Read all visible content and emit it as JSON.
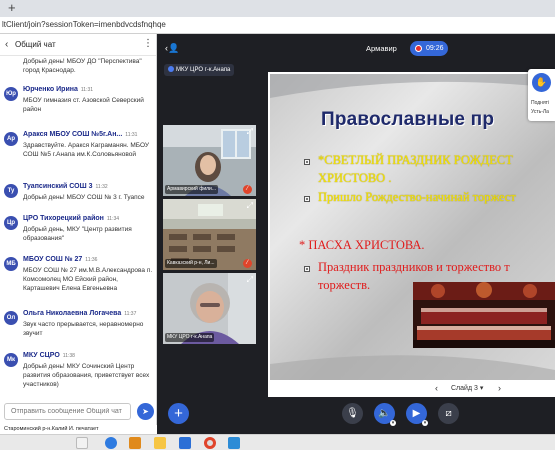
{
  "browser": {
    "new_tab_glyph": "+",
    "url": "ltClient/join?sessionToken=imenbdvcdsfnqhqe"
  },
  "chat": {
    "title": "Общий чат",
    "messages": [
      {
        "initials": "",
        "name": "",
        "time": "",
        "text": "Добрый день! МБОУ ДО \"Перспектива\" город Краснодар."
      },
      {
        "initials": "Юр",
        "name": "Юрченко Ирина",
        "time": "11:31",
        "text": "МБОУ гимназия ст. Азовской Северский район"
      },
      {
        "initials": "Ар",
        "name": "Аракся МБОУ СОШ №5г.Ан...",
        "time": "11:31",
        "text": "Здравствуйте. Аракся Каграманян. МБОУ СОШ №5 г.Анапа им.К.Соловьяновой"
      },
      {
        "initials": "Ту",
        "name": "Туапсинский СОШ 3",
        "time": "11:32",
        "text": "Добрый день! МБОУ СОШ № 3 г. Туапсе"
      },
      {
        "initials": "Цр",
        "name": "ЦРО Тихорецкий район",
        "time": "11:34",
        "text": "Добрый день, МКУ \"Центр развития образования\""
      },
      {
        "initials": "МБ",
        "name": "МБОУ СОШ № 27",
        "time": "11:36",
        "text": "МБОУ СОШ № 27 им.М.В.Александрова п. Комсомолец МО Ейский район, Карташевич Елена Евгеньевна"
      },
      {
        "initials": "Ол",
        "name": "Ольга Николаевна Логачева",
        "time": "11:37",
        "text": "Звук часто прерывается, неравномерно звучит"
      },
      {
        "initials": "Мк",
        "name": "МКУ СЦРО",
        "time": "11:38",
        "text": "Добрый день! МКУ Сочинский Центр развития образования, приветствует всех участников)"
      }
    ],
    "input_placeholder": "Отправить сообщение Общий чат",
    "typing_text": "Староминский р-н.Калий И. печатает"
  },
  "meeting": {
    "room_name": "Армавир",
    "recording_time": "09:26",
    "presenter": "МКУ ЦРО г-к.Анапа",
    "tiles": [
      {
        "label": "Армавирский фили..."
      },
      {
        "label": "Кавказский р-н, Ли..."
      },
      {
        "label": "МКУ ЦРО г-к.Анапа"
      }
    ],
    "slide": {
      "title": "Православные пр",
      "line1": "*СВЕТЛЫЙ ПРАЗДНИК РОЖДЕСТ",
      "line2": "ХРИСТОВО .",
      "line3": "Пришло Рождество-начинай торжест",
      "line4": "* ПАСХА ХРИСТОВА.",
      "line5": "Праздник праздников и торжество т",
      "line6": "торжеств."
    },
    "slide_number": "Слайд 3",
    "colors": {
      "accent": "#3467d8",
      "slide_title": "#1f2a6b",
      "yellow_text": "#f5e400",
      "red_text": "#e01b1b",
      "mute": "#e0442b"
    }
  },
  "float_panel": {
    "line1": "Подняті",
    "line2": "Усть-Ла"
  }
}
